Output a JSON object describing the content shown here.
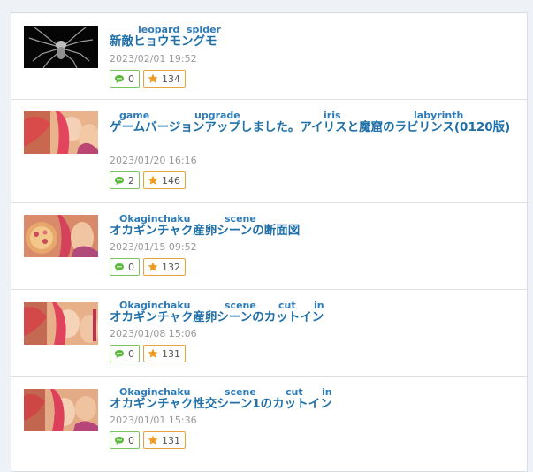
{
  "posts": [
    {
      "ruby": [
        "leopard",
        "spider"
      ],
      "title": "新敵ヒョウモングモ",
      "date": "2023/02/01 19:52",
      "comments": "0",
      "stars": "134",
      "thumb": "spider-thumbnail"
    },
    {
      "ruby": [
        "game",
        "upgrade",
        "iris",
        "labyrinth"
      ],
      "title": "ゲームバージョンアップしました。アイリスと魔窟のラビリンス(0120版)",
      "date": "2023/01/20 16:16",
      "comments": "2",
      "stars": "146",
      "thumb": "anime-art-thumbnail"
    },
    {
      "ruby": [
        "Okaginchaku",
        "scene"
      ],
      "title": "オカギンチャク産卵シーンの断面図",
      "date": "2023/01/15 09:52",
      "comments": "0",
      "stars": "132",
      "thumb": "anime-art-thumbnail"
    },
    {
      "ruby": [
        "Okaginchaku",
        "scene",
        "cut",
        "in"
      ],
      "title": "オカギンチャク産卵シーンのカットイン",
      "date": "2023/01/08 15:06",
      "comments": "0",
      "stars": "131",
      "thumb": "anime-art-thumbnail"
    },
    {
      "ruby": [
        "Okaginchaku",
        "scene",
        "cut",
        "in"
      ],
      "title": "オカギンチャク性交シーン1のカットイン",
      "date": "2023/01/01 15:36",
      "comments": "0",
      "stars": "131",
      "thumb": "anime-art-thumbnail"
    }
  ],
  "icons": {
    "comment": "speech-bubble-icon",
    "star": "star-icon"
  },
  "colors": {
    "title": "#1f6fa8",
    "ruby": "#2e7bb8",
    "comment_border": "#7cc35c",
    "star_border": "#e8a33d",
    "date": "#999999"
  }
}
